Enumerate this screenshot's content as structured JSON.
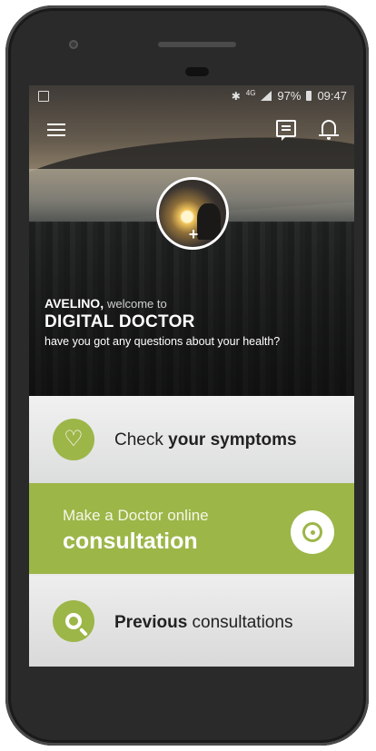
{
  "status_bar": {
    "network": "4G",
    "battery": "97%",
    "time": "09:47"
  },
  "welcome": {
    "user_name": "AVELINO",
    "separator": ",",
    "welcome_text": "welcome to",
    "app_name": "DIGITAL DOCTOR",
    "question": "have you got any questions about your health?"
  },
  "cards": {
    "symptoms": {
      "prefix": "Check ",
      "bold": "your symptoms"
    },
    "consultation": {
      "line1": "Make a Doctor online",
      "line2": "consultation"
    },
    "previous": {
      "bold": "Previous",
      "suffix": " consultations"
    }
  },
  "icons": {
    "menu": "menu-icon",
    "chat": "chat-icon",
    "bell": "bell-icon",
    "symptoms": "heart-icon",
    "consultation": "stethoscope-icon",
    "previous": "search-icon",
    "avatar_add": "plus-icon"
  },
  "colors": {
    "accent": "#9cb648",
    "text_dark": "#222222",
    "text_light": "#ffffff"
  }
}
